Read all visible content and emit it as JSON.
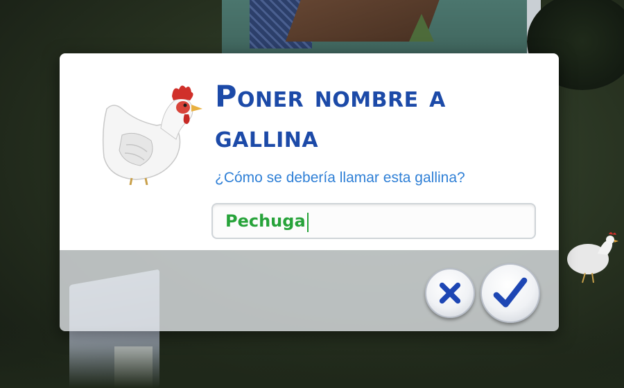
{
  "dialog": {
    "title": "Poner nombre a gallina",
    "question": "¿Cómo se debería llamar esta gallina?",
    "name_value": "Pechuga",
    "portrait_icon": "chicken-portrait",
    "cancel_icon": "close-icon",
    "confirm_icon": "checkmark-icon"
  },
  "colors": {
    "title": "#1c4aa8",
    "question": "#2e7fd6",
    "input_text": "#27a33a",
    "button_glyph": "#1d46b4"
  }
}
